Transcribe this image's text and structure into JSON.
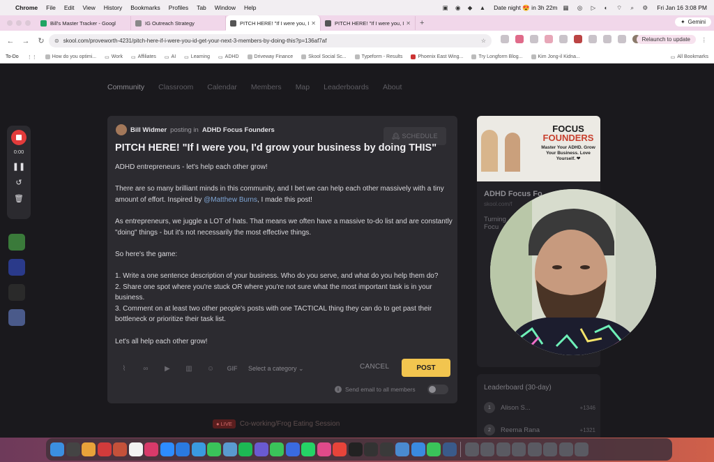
{
  "macos": {
    "app": "Chrome",
    "menus": [
      "File",
      "Edit",
      "View",
      "History",
      "Bookmarks",
      "Profiles",
      "Tab",
      "Window",
      "Help"
    ],
    "status_event": "Date night 😍 in 3h 22m",
    "datetime": "Fri Jan 16  3:08 PM"
  },
  "tabs": [
    {
      "label": "Bill's Master Tracker - Googl",
      "color": "#1fa463"
    },
    {
      "label": "IG Outreach Strategy",
      "color": "#7a7a7a"
    },
    {
      "label": "PITCH HERE! \"If I were you, I",
      "color": "#444444"
    },
    {
      "label": "PITCH HERE! \"If I were you, I",
      "color": "#444444"
    }
  ],
  "gemini_label": "Gemini",
  "url": "skool.com/proveworth-4231/pitch-here-if-i-were-you-id-get-your-next-3-members-by-doing-this?p=136af7af",
  "relaunch_label": "Relaunch to update",
  "bookmarks": [
    "To-Do",
    "How do you optimi...",
    "Work",
    "Affiliates",
    "AI",
    "Learning",
    "ADHD",
    "Driveway Finance",
    "Skool Social Sc...",
    "Typeform - Results",
    "Phoenix East Wing...",
    "Try Longform Blog...",
    "Kim Jong-il Kidna..."
  ],
  "all_bookmarks": "All Bookmarks",
  "nav": [
    "Community",
    "Classroom",
    "Calendar",
    "Members",
    "Map",
    "Leaderboards",
    "About"
  ],
  "post": {
    "author": "Bill Widmer",
    "posting_in": "posting in",
    "group": "ADHD Focus Founders",
    "schedule": "🕰 SCHEDULE",
    "title": "PITCH HERE! \"If I were you, I'd grow your business by doing THIS\"",
    "p1": "ADHD entrepreneurs - let's help each other grow!",
    "p2a": "There are so many brilliant minds in this community, and I bet we can help each other massively with a tiny amount of effort. Inspired by ",
    "p2m": "@Matthew Burns",
    "p2b": ", I made this post!",
    "p3": "As entrepreneurs, we juggle a LOT of hats. That means we often have a massive to-do list and are constantly \"doing\" things - but it's not necessarily the most effective things.",
    "p4": "So here's the game:",
    "l1": "1. Write a one sentence description of your business. Who do you serve, and what do you help them do?",
    "l2": "2. Share one spot where you're stuck OR where you're not sure what the most important task is in your business.",
    "l3": "3. Comment on at least two other people's posts with one TACTICAL thing they can do to get past their bottleneck or prioritize their task list.",
    "p5": "Let's all help each other grow!",
    "gif": "GIF",
    "category": "Select a category ⌄",
    "cancel": "CANCEL",
    "post_btn": "POST",
    "email_label": "Send email to all members"
  },
  "sidebar": {
    "brand_top": "FOCUS",
    "brand_bottom": "FOUNDERS",
    "tagline": "Master Your ADHD. Grow Your Business. Love Yourself. ❤",
    "name": "ADHD Focus Fo",
    "url": "skool.com/f",
    "desc": "Turning",
    "desc2": "Focu"
  },
  "leaderboard": {
    "title": "Leaderboard (30-day)",
    "rows": [
      {
        "rank": "1",
        "name": "Alison S...",
        "pts": "+1346"
      },
      {
        "rank": "2",
        "name": "Reema Rana",
        "pts": "+1321"
      }
    ]
  },
  "live": {
    "tag": "● LIVE",
    "title": "Co-working/Frog Eating Session"
  },
  "recorder": {
    "time": "0:00"
  },
  "dock_count": 34
}
